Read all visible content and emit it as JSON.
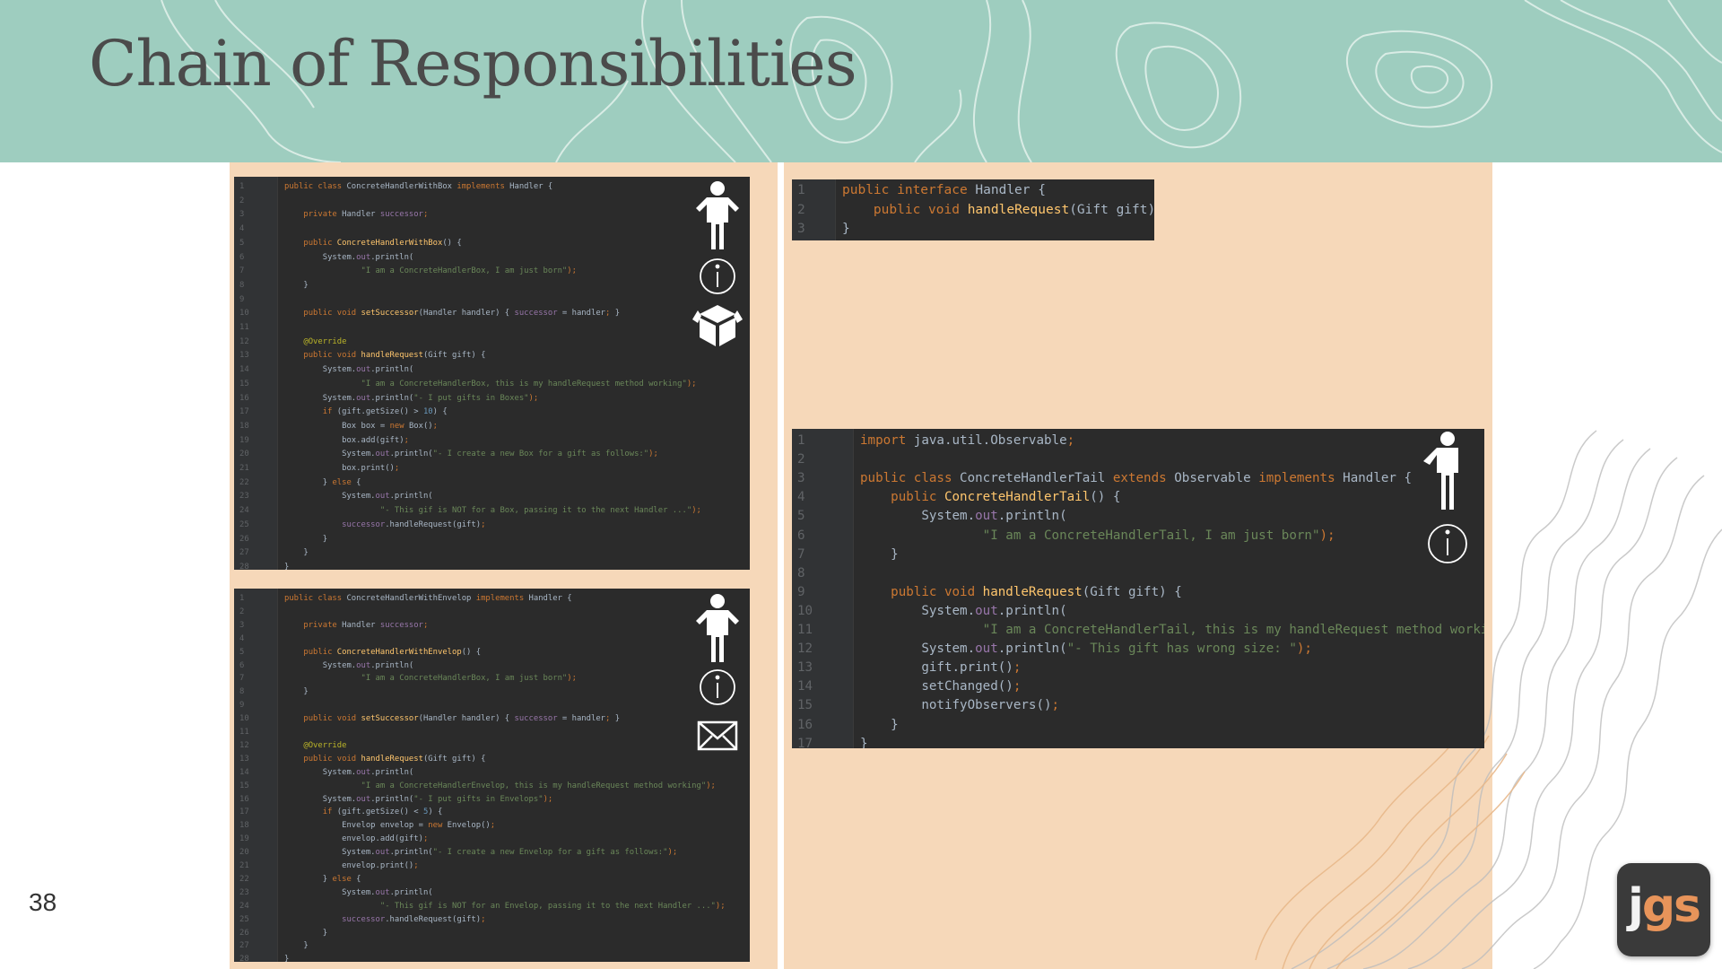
{
  "slide": {
    "title": "Chain of Responsibilities",
    "page_number": "38",
    "logo_text": "jgs"
  },
  "code_blocks": {
    "box": {
      "lines": [
        [
          [
            "kw",
            "public class "
          ],
          [
            "pl",
            "ConcreteHandlerWithBox "
          ],
          [
            "kw",
            "implements "
          ],
          [
            "pl",
            "Handler {"
          ]
        ],
        [],
        [
          [
            "pl",
            "    "
          ],
          [
            "kw",
            "private "
          ],
          [
            "pl",
            "Handler "
          ],
          [
            "fld",
            "successor"
          ],
          [
            "kw",
            ";"
          ]
        ],
        [],
        [
          [
            "pl",
            "    "
          ],
          [
            "kw",
            "public "
          ],
          [
            "fn",
            "ConcreteHandlerWithBox"
          ],
          [
            "pl",
            "() {"
          ]
        ],
        [
          [
            "pl",
            "        System."
          ],
          [
            "fld",
            "out"
          ],
          [
            "pl",
            ".println("
          ]
        ],
        [
          [
            "pl",
            "                "
          ],
          [
            "str",
            "\"I am a ConcreteHandlerBox, I am just born\""
          ],
          [
            "kw",
            ");"
          ]
        ],
        [
          [
            "pl",
            "    }"
          ]
        ],
        [],
        [
          [
            "pl",
            "    "
          ],
          [
            "kw",
            "public void "
          ],
          [
            "fn",
            "setSuccessor"
          ],
          [
            "pl",
            "(Handler handler) { "
          ],
          [
            "fld",
            "successor"
          ],
          [
            "pl",
            " = handler"
          ],
          [
            "kw",
            ";"
          ],
          [
            "pl",
            " }"
          ]
        ],
        [],
        [
          [
            "pl",
            "    "
          ],
          [
            "ann",
            "@Override"
          ]
        ],
        [
          [
            "pl",
            "    "
          ],
          [
            "kw",
            "public void "
          ],
          [
            "fn",
            "handleRequest"
          ],
          [
            "pl",
            "(Gift gift) {"
          ]
        ],
        [
          [
            "pl",
            "        System."
          ],
          [
            "fld",
            "out"
          ],
          [
            "pl",
            ".println("
          ]
        ],
        [
          [
            "pl",
            "                "
          ],
          [
            "str",
            "\"I am a ConcreteHandlerBox, this is my handleRequest method working\""
          ],
          [
            "kw",
            ");"
          ]
        ],
        [
          [
            "pl",
            "        System."
          ],
          [
            "fld",
            "out"
          ],
          [
            "pl",
            ".println("
          ],
          [
            "str",
            "\"- I put gifts in Boxes\""
          ],
          [
            "kw",
            ");"
          ]
        ],
        [
          [
            "pl",
            "        "
          ],
          [
            "kw",
            "if "
          ],
          [
            "pl",
            "(gift.getSize() > "
          ],
          [
            "num",
            "10"
          ],
          [
            "pl",
            ") {"
          ]
        ],
        [
          [
            "pl",
            "            Box box = "
          ],
          [
            "kw",
            "new "
          ],
          [
            "pl",
            "Box()"
          ],
          [
            "kw",
            ";"
          ]
        ],
        [
          [
            "pl",
            "            box.add(gift)"
          ],
          [
            "kw",
            ";"
          ]
        ],
        [
          [
            "pl",
            "            System."
          ],
          [
            "fld",
            "out"
          ],
          [
            "pl",
            ".println("
          ],
          [
            "str",
            "\"- I create a new Box for a gift as follows:\""
          ],
          [
            "kw",
            ");"
          ]
        ],
        [
          [
            "pl",
            "            box.print()"
          ],
          [
            "kw",
            ";"
          ]
        ],
        [
          [
            "pl",
            "        } "
          ],
          [
            "kw",
            "else "
          ],
          [
            "pl",
            "{"
          ]
        ],
        [
          [
            "pl",
            "            System."
          ],
          [
            "fld",
            "out"
          ],
          [
            "pl",
            ".println("
          ]
        ],
        [
          [
            "pl",
            "                    "
          ],
          [
            "str",
            "\"- This gif is NOT for a Box, passing it to the next Handler ...\""
          ],
          [
            "kw",
            ");"
          ]
        ],
        [
          [
            "pl",
            "            "
          ],
          [
            "fld",
            "successor"
          ],
          [
            "pl",
            ".handleRequest(gift)"
          ],
          [
            "kw",
            ";"
          ]
        ],
        [
          [
            "pl",
            "        }"
          ]
        ],
        [
          [
            "pl",
            "    }"
          ]
        ],
        [
          [
            "pl",
            "}"
          ]
        ]
      ]
    },
    "envelop": {
      "lines": [
        [
          [
            "kw",
            "public class "
          ],
          [
            "pl",
            "ConcreteHandlerWithEnvelop "
          ],
          [
            "kw",
            "implements "
          ],
          [
            "pl",
            "Handler {"
          ]
        ],
        [],
        [
          [
            "pl",
            "    "
          ],
          [
            "kw",
            "private "
          ],
          [
            "pl",
            "Handler "
          ],
          [
            "fld",
            "successor"
          ],
          [
            "kw",
            ";"
          ]
        ],
        [],
        [
          [
            "pl",
            "    "
          ],
          [
            "kw",
            "public "
          ],
          [
            "fn",
            "ConcreteHandlerWithEnvelop"
          ],
          [
            "pl",
            "() {"
          ]
        ],
        [
          [
            "pl",
            "        System."
          ],
          [
            "fld",
            "out"
          ],
          [
            "pl",
            ".println("
          ]
        ],
        [
          [
            "pl",
            "                "
          ],
          [
            "str",
            "\"I am a ConcreteHandlerBox, I am just born\""
          ],
          [
            "kw",
            ");"
          ]
        ],
        [
          [
            "pl",
            "    }"
          ]
        ],
        [],
        [
          [
            "pl",
            "    "
          ],
          [
            "kw",
            "public void "
          ],
          [
            "fn",
            "setSuccessor"
          ],
          [
            "pl",
            "(Handler handler) { "
          ],
          [
            "fld",
            "successor"
          ],
          [
            "pl",
            " = handler"
          ],
          [
            "kw",
            ";"
          ],
          [
            "pl",
            " }"
          ]
        ],
        [],
        [
          [
            "pl",
            "    "
          ],
          [
            "ann",
            "@Override"
          ]
        ],
        [
          [
            "pl",
            "    "
          ],
          [
            "kw",
            "public void "
          ],
          [
            "fn",
            "handleRequest"
          ],
          [
            "pl",
            "(Gift gift) {"
          ]
        ],
        [
          [
            "pl",
            "        System."
          ],
          [
            "fld",
            "out"
          ],
          [
            "pl",
            ".println("
          ]
        ],
        [
          [
            "pl",
            "                "
          ],
          [
            "str",
            "\"I am a ConcreteHandlerEnvelop, this is my handleRequest method working\""
          ],
          [
            "kw",
            ");"
          ]
        ],
        [
          [
            "pl",
            "        System."
          ],
          [
            "fld",
            "out"
          ],
          [
            "pl",
            ".println("
          ],
          [
            "str",
            "\"- I put gifts in Envelops\""
          ],
          [
            "kw",
            ");"
          ]
        ],
        [
          [
            "pl",
            "        "
          ],
          [
            "kw",
            "if "
          ],
          [
            "pl",
            "(gift.getSize() < "
          ],
          [
            "num",
            "5"
          ],
          [
            "pl",
            ") {"
          ]
        ],
        [
          [
            "pl",
            "            Envelop envelop = "
          ],
          [
            "kw",
            "new "
          ],
          [
            "pl",
            "Envelop()"
          ],
          [
            "kw",
            ";"
          ]
        ],
        [
          [
            "pl",
            "            envelop.add(gift)"
          ],
          [
            "kw",
            ";"
          ]
        ],
        [
          [
            "pl",
            "            System."
          ],
          [
            "fld",
            "out"
          ],
          [
            "pl",
            ".println("
          ],
          [
            "str",
            "\"- I create a new Envelop for a gift as follows:\""
          ],
          [
            "kw",
            ");"
          ]
        ],
        [
          [
            "pl",
            "            envelop.print()"
          ],
          [
            "kw",
            ";"
          ]
        ],
        [
          [
            "pl",
            "        } "
          ],
          [
            "kw",
            "else "
          ],
          [
            "pl",
            "{"
          ]
        ],
        [
          [
            "pl",
            "            System."
          ],
          [
            "fld",
            "out"
          ],
          [
            "pl",
            ".println("
          ]
        ],
        [
          [
            "pl",
            "                    "
          ],
          [
            "str",
            "\"- This gif is NOT for an Envelop, passing it to the next Handler ...\""
          ],
          [
            "kw",
            ");"
          ]
        ],
        [
          [
            "pl",
            "            "
          ],
          [
            "fld",
            "successor"
          ],
          [
            "pl",
            ".handleRequest(gift)"
          ],
          [
            "kw",
            ";"
          ]
        ],
        [
          [
            "pl",
            "        }"
          ]
        ],
        [
          [
            "pl",
            "    }"
          ]
        ],
        [
          [
            "pl",
            "}"
          ]
        ]
      ]
    },
    "interface": {
      "lines": [
        [
          [
            "kw",
            "public interface "
          ],
          [
            "pl",
            "Handler {"
          ]
        ],
        [
          [
            "pl",
            "    "
          ],
          [
            "kw",
            "public void "
          ],
          [
            "fn",
            "handleRequest"
          ],
          [
            "pl",
            "(Gift gift)"
          ],
          [
            "kw",
            ";"
          ]
        ],
        [
          [
            "pl",
            "}"
          ]
        ]
      ]
    },
    "tail": {
      "lines": [
        [
          [
            "kw",
            "import "
          ],
          [
            "pl",
            "java.util.Observable"
          ],
          [
            "kw",
            ";"
          ]
        ],
        [],
        [
          [
            "kw",
            "public class "
          ],
          [
            "pl",
            "ConcreteHandlerTail "
          ],
          [
            "kw",
            "extends "
          ],
          [
            "pl",
            "Observable "
          ],
          [
            "kw",
            "implements "
          ],
          [
            "pl",
            "Handler {"
          ]
        ],
        [
          [
            "pl",
            "    "
          ],
          [
            "kw",
            "public "
          ],
          [
            "fn",
            "ConcreteHandlerTail"
          ],
          [
            "pl",
            "() {"
          ]
        ],
        [
          [
            "pl",
            "        System."
          ],
          [
            "fld",
            "out"
          ],
          [
            "pl",
            ".println("
          ]
        ],
        [
          [
            "pl",
            "                "
          ],
          [
            "str",
            "\"I am a ConcreteHandlerTail, I am just born\""
          ],
          [
            "kw",
            ");"
          ]
        ],
        [
          [
            "pl",
            "    }"
          ]
        ],
        [],
        [
          [
            "pl",
            "    "
          ],
          [
            "kw",
            "public void "
          ],
          [
            "fn",
            "handleRequest"
          ],
          [
            "pl",
            "(Gift gift) {"
          ]
        ],
        [
          [
            "pl",
            "        System."
          ],
          [
            "fld",
            "out"
          ],
          [
            "pl",
            ".println("
          ]
        ],
        [
          [
            "pl",
            "                "
          ],
          [
            "str",
            "\"I am a ConcreteHandlerTail, this is my handleRequest method working\""
          ],
          [
            "kw",
            ");"
          ]
        ],
        [
          [
            "pl",
            "        System."
          ],
          [
            "fld",
            "out"
          ],
          [
            "pl",
            ".println("
          ],
          [
            "str",
            "\"- This gift has wrong size: \""
          ],
          [
            "kw",
            ");"
          ]
        ],
        [
          [
            "pl",
            "        gift.print()"
          ],
          [
            "kw",
            ";"
          ]
        ],
        [
          [
            "pl",
            "        setChanged()"
          ],
          [
            "kw",
            ";"
          ]
        ],
        [
          [
            "pl",
            "        notifyObservers()"
          ],
          [
            "kw",
            ";"
          ]
        ],
        [
          [
            "pl",
            "    }"
          ]
        ],
        [
          [
            "pl",
            "}"
          ]
        ]
      ]
    }
  },
  "icons": {
    "box_panel": [
      "person-icon",
      "info-icon",
      "box-icon"
    ],
    "envelop_panel": [
      "person-icon",
      "info-icon",
      "envelope-icon"
    ],
    "tail_panel": [
      "person-icon",
      "info-icon"
    ]
  },
  "colors": {
    "header": "#9ecdbf",
    "panel": "#f6d8b9",
    "code_bg": "#2b2b2b",
    "keyword": "#cc7832",
    "string": "#6a8759",
    "method": "#ffc66d",
    "field": "#9876aa"
  }
}
